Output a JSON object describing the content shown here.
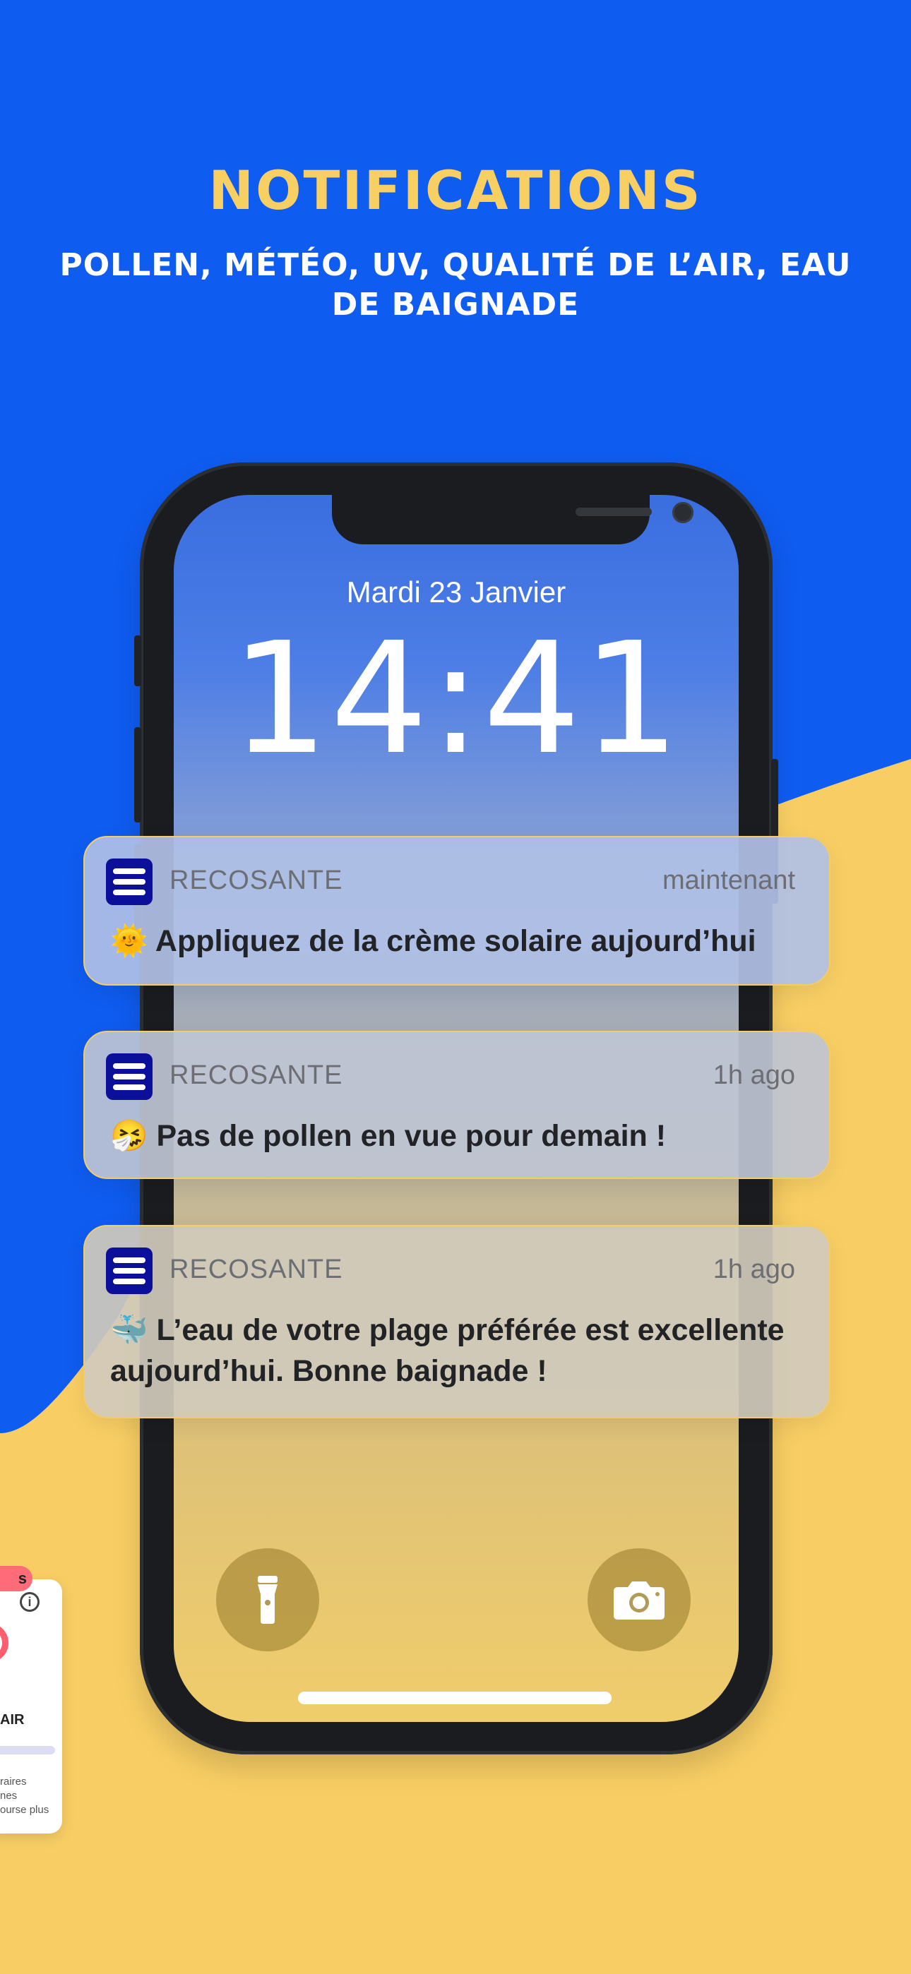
{
  "header": {
    "title": "NOTIFICATIONS",
    "subtitle": "POLLEN, MÉTÉO, UV, QUALITÉ DE L’AIR, EAU DE BAIGNADE"
  },
  "lock_screen": {
    "date": "Mardi 23 Janvier",
    "time": "14:41"
  },
  "notifications": [
    {
      "app": "RECOSANTE",
      "time": "maintenant",
      "emoji": "🌞",
      "message": "Appliquez de la crème solaire aujourd’hui"
    },
    {
      "app": "RECOSANTE",
      "time": "1h ago",
      "emoji": "🤧",
      "message": "Pas de pollen en vue pour demain !"
    },
    {
      "app": "RECOSANTE",
      "time": "1h ago",
      "emoji": "🐳",
      "message": "L’eau de votre plage préférée est excellente aujourd’hui. Bonne baignade !"
    }
  ],
  "partial_card": {
    "badge": "s",
    "info": "i",
    "label": "AIR",
    "lines": [
      "raires",
      "nes",
      "ourse plus"
    ]
  },
  "colors": {
    "background_blue": "#0f5cf0",
    "background_yellow": "#f8ce64",
    "title_yellow": "#f7cf63",
    "app_icon": "#0c0f9a"
  },
  "icons": {
    "app": "menu-lines-icon",
    "flashlight": "flashlight-icon",
    "camera": "camera-icon"
  }
}
